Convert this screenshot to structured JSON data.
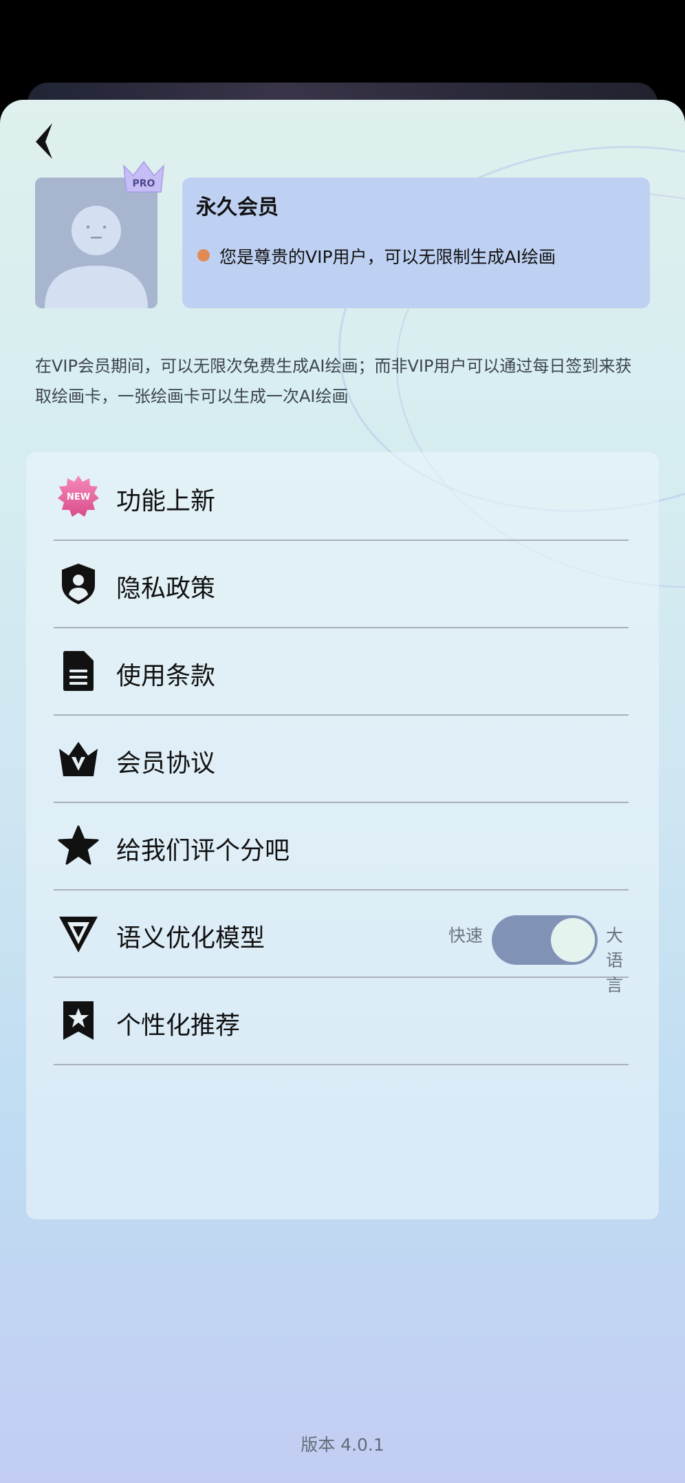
{
  "header": {
    "back_icon": "chevron-left-icon"
  },
  "profile": {
    "avatar_icon": "default-avatar-icon",
    "badge_text": "PRO"
  },
  "membership": {
    "title": "永久会员",
    "description": "您是尊贵的VIP用户，可以无限制生成AI绘画",
    "dot_color": "#e28a55"
  },
  "vip_info": "在VIP会员期间，可以无限次免费生成AI绘画；而非VIP用户可以通过每日签到来获取绘画卡，一张绘画卡可以生成一次AI绘画",
  "menu": {
    "items": [
      {
        "label": "功能上新",
        "icon": "new-badge-icon",
        "badge": "NEW"
      },
      {
        "label": "隐私政策",
        "icon": "shield-user-icon"
      },
      {
        "label": "使用条款",
        "icon": "document-icon"
      },
      {
        "label": "会员协议",
        "icon": "crown-icon"
      },
      {
        "label": "给我们评个分吧",
        "icon": "star-icon"
      },
      {
        "label": "语义优化模型",
        "icon": "model-logo-icon"
      },
      {
        "label": "个性化推荐",
        "icon": "bookmark-star-icon"
      }
    ],
    "toggle": {
      "left_label": "快速",
      "right_label": "大语言",
      "on": true,
      "track_color": "#8093b7"
    }
  },
  "footer": {
    "version": "版本 4.0.1"
  }
}
